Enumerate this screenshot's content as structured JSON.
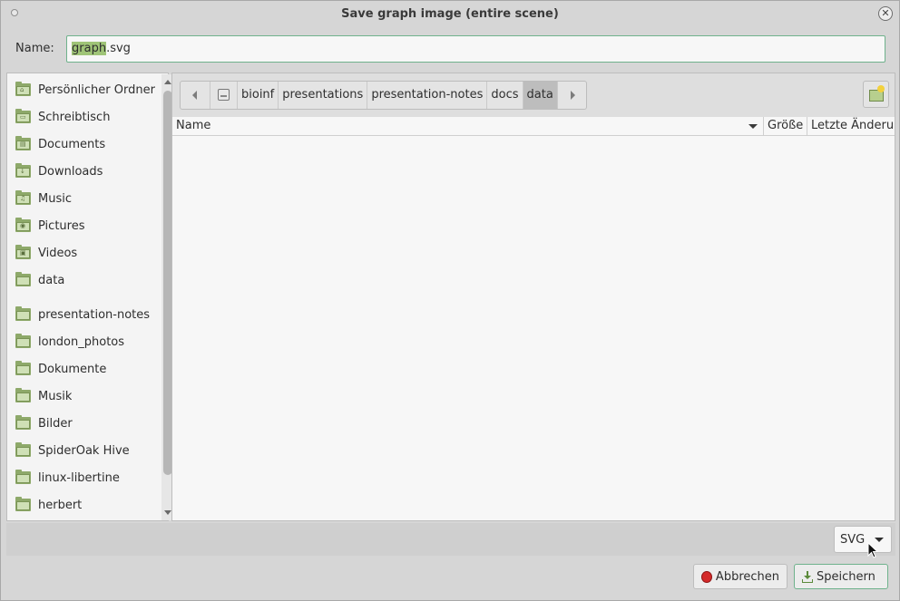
{
  "window": {
    "title": "Save graph image (entire scene)"
  },
  "name_row": {
    "label": "Name:",
    "value_selected": "graph",
    "value_rest": ".svg"
  },
  "sidebar": {
    "items": [
      {
        "label": "Persönlicher Ordner",
        "glyph": "⌂"
      },
      {
        "label": "Schreibtisch",
        "glyph": "▭"
      },
      {
        "label": "Documents",
        "glyph": "▤"
      },
      {
        "label": "Downloads",
        "glyph": "↓"
      },
      {
        "label": "Music",
        "glyph": "♫"
      },
      {
        "label": "Pictures",
        "glyph": "◉"
      },
      {
        "label": "Videos",
        "glyph": "▣"
      },
      {
        "label": "data",
        "glyph": ""
      },
      {
        "label": "presentation-notes",
        "glyph": ""
      },
      {
        "label": "london_photos",
        "glyph": ""
      },
      {
        "label": "Dokumente",
        "glyph": ""
      },
      {
        "label": "Musik",
        "glyph": ""
      },
      {
        "label": "Bilder",
        "glyph": ""
      },
      {
        "label": "SpiderOak Hive",
        "glyph": ""
      },
      {
        "label": "linux-libertine",
        "glyph": ""
      },
      {
        "label": "herbert",
        "glyph": ""
      }
    ]
  },
  "pathbar": {
    "segments": [
      "bioinf",
      "presentations",
      "presentation-notes",
      "docs",
      "data"
    ],
    "active_index": 4
  },
  "file_list": {
    "columns": {
      "name": "Name",
      "size": "Größe",
      "modified": "Letzte Änderung"
    },
    "rows": []
  },
  "filter": {
    "selected": "SVG"
  },
  "buttons": {
    "cancel": "Abbrechen",
    "save": "Speichern"
  }
}
